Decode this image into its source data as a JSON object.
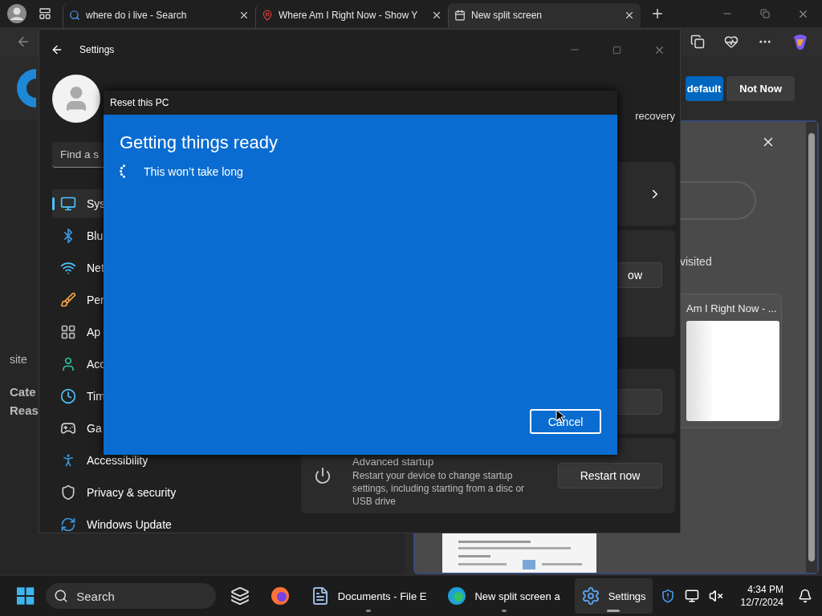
{
  "browser": {
    "tabs": [
      {
        "title": "where do i live - Search",
        "kind": "search",
        "selected": false
      },
      {
        "title": "Where Am I Right Now - Show Y",
        "kind": "map",
        "selected": false
      },
      {
        "title": "New split screen",
        "kind": "page",
        "selected": true
      }
    ],
    "banner_buttons": [
      {
        "label": "default",
        "primary": true
      },
      {
        "label": "Not Now",
        "primary": false
      }
    ],
    "left_panel": {
      "text": "site",
      "bold_lines": [
        "Cate",
        "Reas"
      ]
    },
    "right_panel": {
      "visited": "visited",
      "card_title": "Am I Right Now - ..."
    }
  },
  "settings": {
    "title": "Settings",
    "subtitle": "recovery",
    "search_placeholder": "Find a s",
    "nav": [
      {
        "label": "Sys",
        "selected": true
      },
      {
        "label": "Blu",
        "selected": false
      },
      {
        "label": "Net",
        "selected": false
      },
      {
        "label": "Per",
        "selected": false
      },
      {
        "label": "Ap",
        "selected": false
      },
      {
        "label": "Acc",
        "selected": false
      },
      {
        "label": "Tim",
        "selected": false
      },
      {
        "label": "Ga",
        "selected": false
      },
      {
        "label": "Accessibility",
        "selected": false
      },
      {
        "label": "Privacy & security",
        "selected": false
      },
      {
        "label": "Windows Update",
        "selected": false
      }
    ],
    "cards": [
      {
        "kind": "link"
      },
      {
        "kind": "button",
        "button": "ow"
      },
      {
        "kind": "button"
      },
      {
        "kind": "startup",
        "title": "Advanced startup",
        "description": "Restart your device to change startup settings, including starting from a disc or USB drive",
        "button": "Restart now"
      }
    ]
  },
  "dialog": {
    "title": "Reset this PC",
    "heading": "Getting things ready",
    "status": "This won’t take long",
    "cancel": "Cancel"
  },
  "taskbar": {
    "search_placeholder": "Search",
    "apps": [
      {
        "kind": "taskview",
        "running": false,
        "active": false
      },
      {
        "kind": "firefox",
        "running": false,
        "active": false
      },
      {
        "kind": "explorer",
        "label": "Documents - File E",
        "running": true,
        "active": false
      },
      {
        "kind": "edge",
        "label": "New split screen a",
        "running": true,
        "active": false
      },
      {
        "kind": "settings",
        "label": "Settings",
        "running": true,
        "active": true
      }
    ],
    "time": "4:34 PM",
    "date": "12/7/2024"
  }
}
